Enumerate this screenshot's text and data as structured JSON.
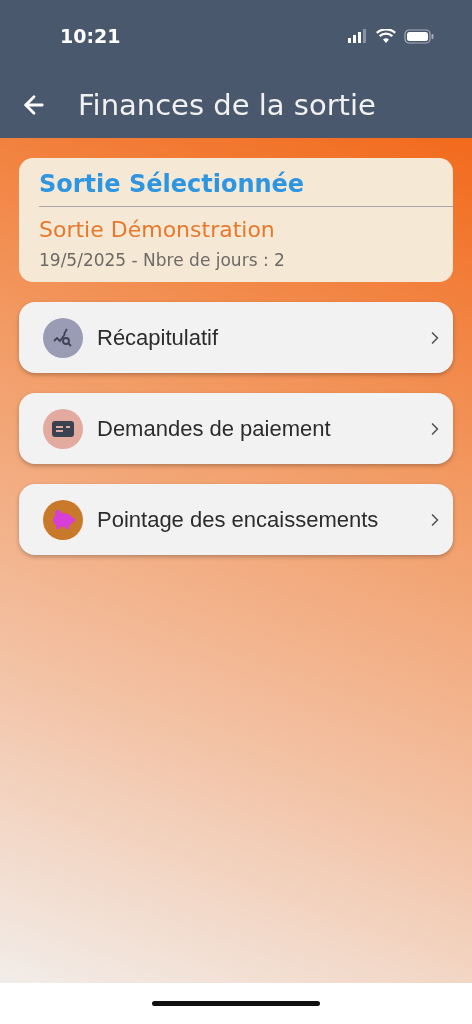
{
  "status_bar": {
    "time": "10:21"
  },
  "header": {
    "title": "Finances de la sortie"
  },
  "selected_outing": {
    "heading": "Sortie Sélectionnée",
    "name": "Sortie Démonstration",
    "details": "19/5/2025 - Nbre de jours : 2"
  },
  "menu": [
    {
      "kind": "summary",
      "label": "Récapitulatif"
    },
    {
      "kind": "payment",
      "label": "Demandes de paiement"
    },
    {
      "kind": "savings",
      "label": "Pointage des encaissements"
    }
  ]
}
